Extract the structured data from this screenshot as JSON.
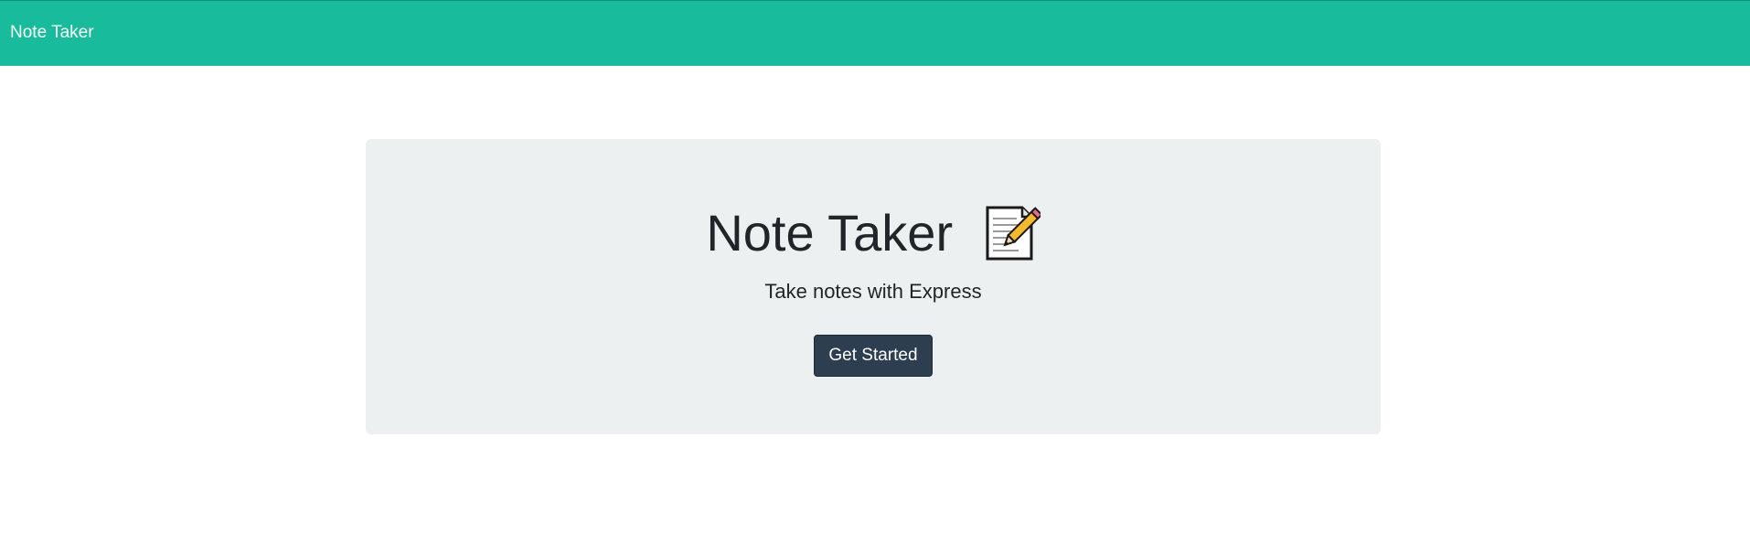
{
  "navbar": {
    "brand": "Note Taker",
    "background_color": "#18bc9c"
  },
  "hero": {
    "title": "Note Taker",
    "title_icon": "memo-icon",
    "subtitle": "Take notes with Express",
    "background_color": "#ecf0f1"
  },
  "cta": {
    "label": "Get Started",
    "background_color": "#2c3e50"
  }
}
